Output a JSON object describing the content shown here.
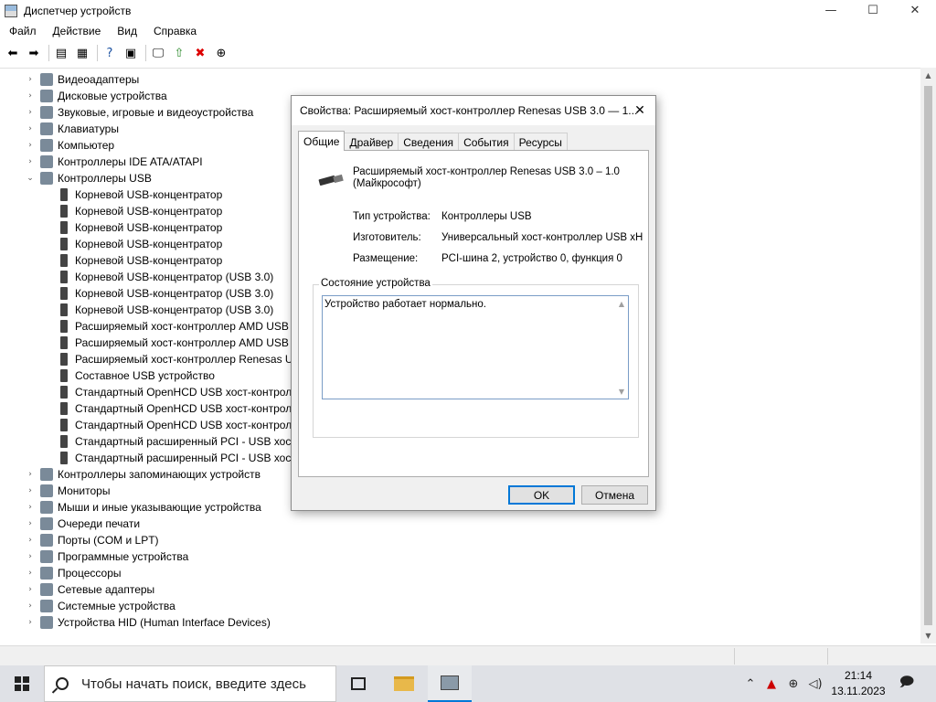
{
  "window": {
    "title": "Диспетчер устройств",
    "controls": {
      "minimize": "—",
      "maximize": "☐",
      "close": "✕"
    }
  },
  "menu": [
    "Файл",
    "Действие",
    "Вид",
    "Справка"
  ],
  "toolbar": [
    {
      "icon": "back-arrow-icon",
      "glyph": "⬅"
    },
    {
      "icon": "forward-arrow-icon",
      "glyph": "➡"
    },
    {
      "icon": "properties-view-icon",
      "glyph": "▤"
    },
    {
      "icon": "properties-icon",
      "glyph": "▦"
    },
    {
      "icon": "help-icon",
      "glyph": "?"
    },
    {
      "icon": "show-hidden-icon",
      "glyph": "▣"
    },
    {
      "icon": "scan-hardware-icon",
      "glyph": "🖵"
    },
    {
      "icon": "update-driver-icon",
      "glyph": "⇧"
    },
    {
      "icon": "uninstall-device-icon",
      "glyph": "✖"
    },
    {
      "icon": "disable-device-icon",
      "glyph": "⊕"
    }
  ],
  "tree": [
    {
      "label": "Видеоадаптеры",
      "level": 0,
      "expander": "›"
    },
    {
      "label": "Дисковые устройства",
      "level": 0,
      "expander": "›"
    },
    {
      "label": "Звуковые, игровые и видеоустройства",
      "level": 0,
      "expander": "›"
    },
    {
      "label": "Клавиатуры",
      "level": 0,
      "expander": "›"
    },
    {
      "label": "Компьютер",
      "level": 0,
      "expander": "›"
    },
    {
      "label": "Контроллеры IDE ATA/ATAPI",
      "level": 0,
      "expander": "›"
    },
    {
      "label": "Контроллеры USB",
      "level": 0,
      "expander": "⌄"
    },
    {
      "label": "Корневой USB-концентратор",
      "level": 1
    },
    {
      "label": "Корневой USB-концентратор",
      "level": 1
    },
    {
      "label": "Корневой USB-концентратор",
      "level": 1
    },
    {
      "label": "Корневой USB-концентратор",
      "level": 1
    },
    {
      "label": "Корневой USB-концентратор",
      "level": 1
    },
    {
      "label": "Корневой USB-концентратор (USB 3.0)",
      "level": 1
    },
    {
      "label": "Корневой USB-концентратор (USB 3.0)",
      "level": 1
    },
    {
      "label": "Корневой USB-концентратор (USB 3.0)",
      "level": 1
    },
    {
      "label": "Расширяемый хост-контроллер AMD USB",
      "level": 1
    },
    {
      "label": "Расширяемый хост-контроллер AMD USB",
      "level": 1
    },
    {
      "label": "Расширяемый хост-контроллер Renesas U",
      "level": 1
    },
    {
      "label": "Составное USB устройство",
      "level": 1
    },
    {
      "label": "Стандартный OpenHCD USB хост-контролл",
      "level": 1
    },
    {
      "label": "Стандартный OpenHCD USB хост-контролл",
      "level": 1
    },
    {
      "label": "Стандартный OpenHCD USB хост-контролл",
      "level": 1
    },
    {
      "label": "Стандартный расширенный PCI - USB хост",
      "level": 1
    },
    {
      "label": "Стандартный расширенный PCI - USB хост",
      "level": 1
    },
    {
      "label": "Контроллеры запоминающих устройств",
      "level": 0,
      "expander": "›"
    },
    {
      "label": "Мониторы",
      "level": 0,
      "expander": "›"
    },
    {
      "label": "Мыши и иные указывающие устройства",
      "level": 0,
      "expander": "›"
    },
    {
      "label": "Очереди печати",
      "level": 0,
      "expander": "›"
    },
    {
      "label": "Порты (COM и LPT)",
      "level": 0,
      "expander": "›"
    },
    {
      "label": "Программные устройства",
      "level": 0,
      "expander": "›"
    },
    {
      "label": "Процессоры",
      "level": 0,
      "expander": "›"
    },
    {
      "label": "Сетевые адаптеры",
      "level": 0,
      "expander": "›"
    },
    {
      "label": "Системные устройства",
      "level": 0,
      "expander": "›"
    },
    {
      "label": "Устройства HID (Human Interface Devices)",
      "level": 0,
      "expander": "›"
    }
  ],
  "dialog": {
    "title": "Свойства: Расширяемый хост-контроллер Renesas USB 3.0 — 1...",
    "close": "✕",
    "tabs": [
      "Общие",
      "Драйвер",
      "Сведения",
      "События",
      "Ресурсы"
    ],
    "active_tab": 0,
    "device_name_line1": "Расширяемый хост-контроллер Renesas USB 3.0 – 1.0",
    "device_name_line2": "(Майкрософт)",
    "properties": [
      {
        "label": "Тип устройства:",
        "value": "Контроллеры USB"
      },
      {
        "label": "Изготовитель:",
        "value": "Универсальный хост-контроллер USB xHC"
      },
      {
        "label": "Размещение:",
        "value": "PCI-шина 2, устройство 0, функция 0"
      }
    ],
    "status_group_label": "Состояние устройства",
    "status_text": "Устройство работает нормально.",
    "ok_label": "OK",
    "cancel_label": "Отмена"
  },
  "taskbar": {
    "search_placeholder": "Чтобы начать поиск, введите здесь",
    "time": "21:14",
    "date": "13.11.2023"
  }
}
